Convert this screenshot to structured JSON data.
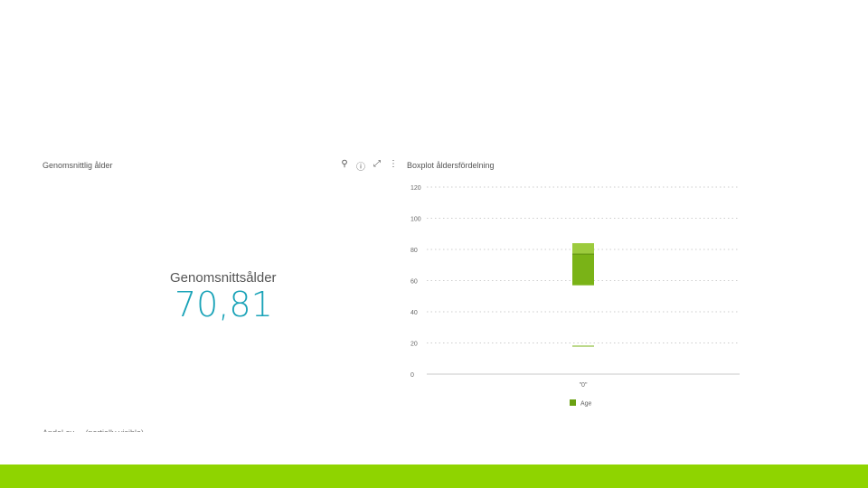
{
  "left_panel": {
    "title": "Genomsnittlig ålder",
    "kpi_label": "Genomsnittsålder",
    "kpi_value": "70,81",
    "next_title": "Andel av ... (partially visible)"
  },
  "toolbar": {
    "icons": [
      "lightbulb-icon",
      "info-icon",
      "expand-icon",
      "more-vertical-icon"
    ],
    "glyphs": [
      "⚲",
      "ⓘ",
      "⤢",
      "⋮"
    ]
  },
  "right_panel": {
    "title": "Boxplot åldersfördelning"
  },
  "colors": {
    "accent": "#1aa3b8",
    "footer": "#8fd400",
    "box_upper": "#9ccb3d",
    "box_lower": "#7ab317",
    "legend": "#6aa112"
  },
  "chart_data": {
    "type": "boxplot",
    "title": "Boxplot åldersfördelning",
    "categories": [
      "\"0\""
    ],
    "series": [
      {
        "name": "Age",
        "box": {
          "whisker_low": 18,
          "q1": 57,
          "median": 77,
          "q3": 84,
          "whisker_high": 84
        }
      }
    ],
    "yticks": [
      0,
      20,
      40,
      60,
      80,
      100,
      120
    ],
    "ylim": [
      0,
      120
    ],
    "grid": true,
    "legend": "bottom"
  }
}
